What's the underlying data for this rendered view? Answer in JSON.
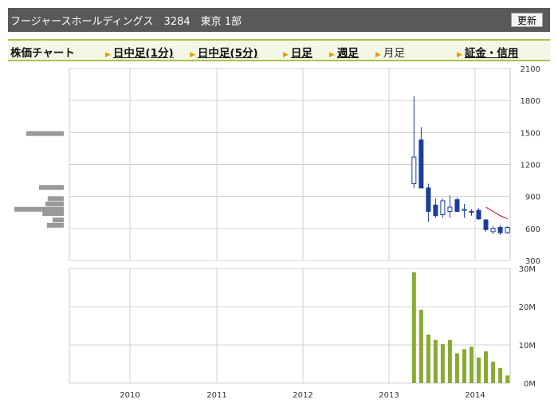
{
  "header": {
    "title": "フージャースホールディングス　3284　東京 1部",
    "refresh_label": "更新"
  },
  "tabs": {
    "chart_label": "株価チャート",
    "items": [
      {
        "label": "日中足(1分)",
        "active": false
      },
      {
        "label": "日中足(5分)",
        "active": false
      },
      {
        "label": "日足",
        "active": false
      },
      {
        "label": "週足",
        "active": false
      },
      {
        "label": "月足",
        "active": true
      },
      {
        "label": "証金・信用",
        "active": false
      }
    ]
  },
  "colors": {
    "down_candle": "#1a3c9c",
    "volume_bar": "#88aa33",
    "moving_average": "#c0002a",
    "volume_profile": "#999999",
    "grid": "#d0d0d0"
  },
  "chart_data": [
    {
      "type": "candlestick",
      "x_ticks": [
        "2010",
        "2011",
        "2012",
        "2013",
        "2014"
      ],
      "y_ticks": [
        "2100",
        "1800",
        "1500",
        "1200",
        "900",
        "600",
        "300"
      ],
      "ylim": [
        300,
        2100
      ],
      "grid": true,
      "candles": [
        {
          "date": "2013-04",
          "open": 1020,
          "high": 1840,
          "low": 980,
          "close": 1270
        },
        {
          "date": "2013-05",
          "open": 1430,
          "high": 1550,
          "low": 1000,
          "close": 980
        },
        {
          "date": "2013-06",
          "open": 980,
          "high": 1020,
          "low": 660,
          "close": 760
        },
        {
          "date": "2013-07",
          "open": 820,
          "high": 880,
          "low": 700,
          "close": 720
        },
        {
          "date": "2013-08",
          "open": 730,
          "high": 880,
          "low": 700,
          "close": 860
        },
        {
          "date": "2013-09",
          "open": 760,
          "high": 910,
          "low": 700,
          "close": 800
        },
        {
          "date": "2013-10",
          "open": 870,
          "high": 890,
          "low": 760,
          "close": 760
        },
        {
          "date": "2013-11",
          "open": 770,
          "high": 830,
          "low": 700,
          "close": 780
        },
        {
          "date": "2013-12",
          "open": 760,
          "high": 780,
          "low": 720,
          "close": 760
        },
        {
          "date": "2014-01",
          "open": 770,
          "high": 790,
          "low": 680,
          "close": 690
        },
        {
          "date": "2014-02",
          "open": 680,
          "high": 690,
          "low": 570,
          "close": 590
        },
        {
          "date": "2014-03",
          "open": 570,
          "high": 620,
          "low": 550,
          "close": 600
        },
        {
          "date": "2014-04",
          "open": 610,
          "high": 630,
          "low": 540,
          "close": 560
        },
        {
          "date": "2014-05",
          "open": 560,
          "high": 620,
          "low": 550,
          "close": 610
        }
      ],
      "moving_average": [
        {
          "date": "2014-02",
          "value": 800
        },
        {
          "date": "2014-03",
          "value": 760
        },
        {
          "date": "2014-04",
          "value": 720
        },
        {
          "date": "2014-05",
          "value": 690
        }
      ],
      "volume_profile": [
        {
          "price": 1490,
          "weight": 1.0
        },
        {
          "price": 985,
          "weight": 0.66
        },
        {
          "price": 880,
          "weight": 0.43
        },
        {
          "price": 830,
          "weight": 0.49
        },
        {
          "price": 780,
          "weight": 1.32
        },
        {
          "price": 740,
          "weight": 0.57
        },
        {
          "price": 680,
          "weight": 0.3
        },
        {
          "price": 630,
          "weight": 0.45
        }
      ]
    },
    {
      "type": "bar",
      "x_ticks": [
        "2010",
        "2011",
        "2012",
        "2013",
        "2014"
      ],
      "y_ticks": [
        "30M",
        "20M",
        "10M",
        "0M"
      ],
      "ylim": [
        0,
        30
      ],
      "unit": "M",
      "grid": true,
      "bars": [
        {
          "date": "2013-04",
          "value": 29
        },
        {
          "date": "2013-05",
          "value": 19.2
        },
        {
          "date": "2013-06",
          "value": 12.7
        },
        {
          "date": "2013-07",
          "value": 11.3
        },
        {
          "date": "2013-08",
          "value": 10.2
        },
        {
          "date": "2013-09",
          "value": 11.3
        },
        {
          "date": "2013-10",
          "value": 7.8
        },
        {
          "date": "2013-11",
          "value": 8.9
        },
        {
          "date": "2013-12",
          "value": 9.5
        },
        {
          "date": "2014-01",
          "value": 6.7
        },
        {
          "date": "2014-02",
          "value": 8.3
        },
        {
          "date": "2014-03",
          "value": 5.6
        },
        {
          "date": "2014-04",
          "value": 4.0
        },
        {
          "date": "2014-05",
          "value": 2.0
        }
      ]
    }
  ]
}
